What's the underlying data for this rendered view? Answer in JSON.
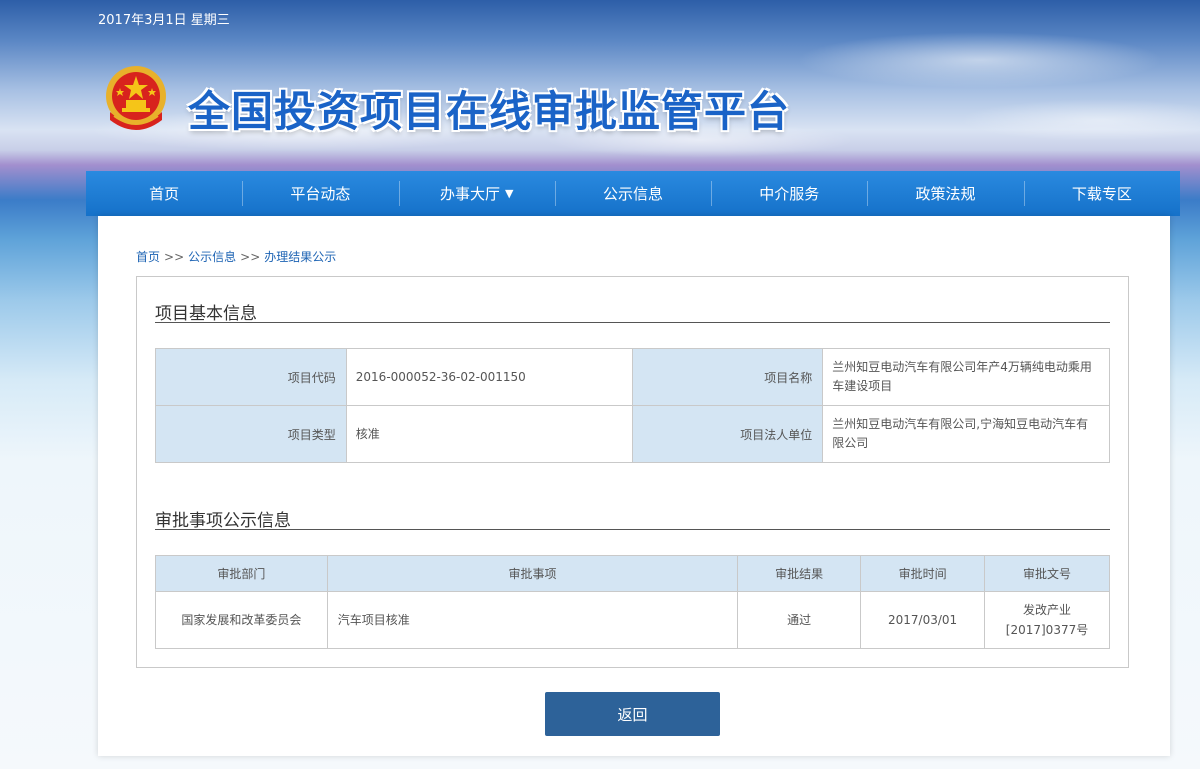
{
  "header": {
    "date": "2017年3月1日 星期三",
    "site_title": "全国投资项目在线审批监管平台",
    "emblem_icon": "national-emblem-icon"
  },
  "nav": {
    "items": [
      {
        "label": "首页"
      },
      {
        "label": "平台动态"
      },
      {
        "label": "办事大厅",
        "arrow": "▼"
      },
      {
        "label": "公示信息"
      },
      {
        "label": "中介服务"
      },
      {
        "label": "政策法规"
      },
      {
        "label": "下载专区"
      }
    ]
  },
  "breadcrumb": {
    "items": [
      "首页",
      "公示信息",
      "办理结果公示"
    ],
    "separator": ">>"
  },
  "basic_info": {
    "title": "项目基本信息",
    "rows": [
      {
        "label1": "项目代码",
        "value1": "2016-000052-36-02-001150",
        "label2": "项目名称",
        "value2": "兰州知豆电动汽车有限公司年产4万辆纯电动乘用车建设项目"
      },
      {
        "label1": "项目类型",
        "value1": "核准",
        "label2": "项目法人单位",
        "value2": "兰州知豆电动汽车有限公司,宁海知豆电动汽车有限公司"
      }
    ]
  },
  "approval": {
    "title": "审批事项公示信息",
    "headers": [
      "审批部门",
      "审批事项",
      "审批结果",
      "审批时间",
      "审批文号"
    ],
    "rows": [
      {
        "dept": "国家发展和改革委员会",
        "item": "汽车项目核准",
        "result": "通过",
        "time": "2017/03/01",
        "doc_no": "发改产业\n[2017]0377号"
      }
    ]
  },
  "back_button": {
    "label": "返回"
  }
}
